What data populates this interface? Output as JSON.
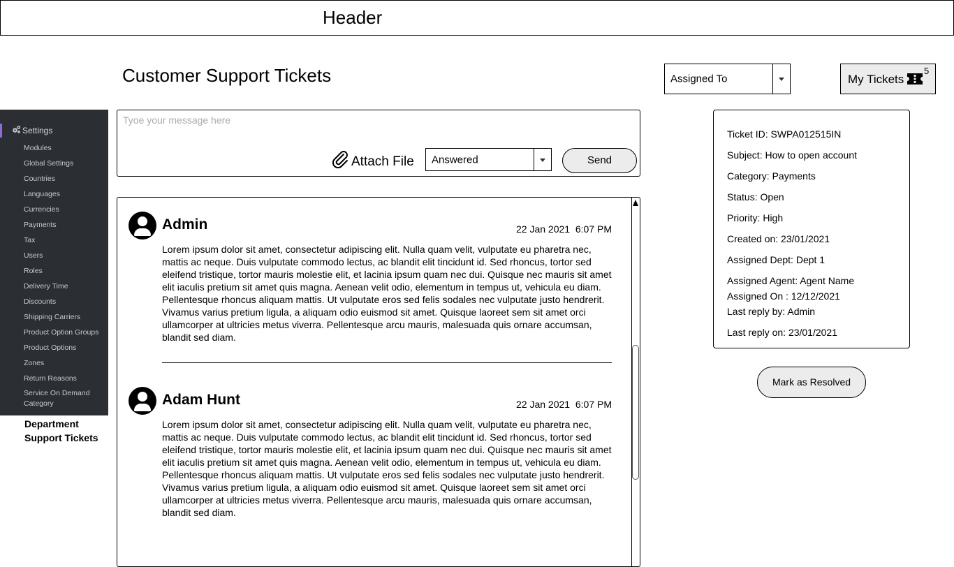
{
  "header": {
    "title": "Header"
  },
  "page": {
    "title": "Customer Support Tickets"
  },
  "filters": {
    "assigned_to": {
      "value": "Assigned To"
    },
    "my_tickets": {
      "label": "My Tickets",
      "count": "5",
      "icon": "ticket-icon"
    }
  },
  "sidebar": {
    "settings_label": "Settings",
    "settings_icon": "gears-icon",
    "accent": "#8e6bd8",
    "background": "#2b2f33",
    "items": [
      {
        "label": "Modules"
      },
      {
        "label": "Global Settings"
      },
      {
        "label": "Countries"
      },
      {
        "label": "Languages"
      },
      {
        "label": "Currencies"
      },
      {
        "label": "Payments"
      },
      {
        "label": "Tax"
      },
      {
        "label": "Users"
      },
      {
        "label": "Roles"
      },
      {
        "label": "Delivery Time"
      },
      {
        "label": "Discounts"
      },
      {
        "label": "Shipping Carriers"
      },
      {
        "label": "Product Option Groups"
      },
      {
        "label": "Product Options"
      },
      {
        "label": "Zones"
      },
      {
        "label": "Return Reasons"
      },
      {
        "label": "Service On Demand Category"
      }
    ],
    "department_link": "Department Support Tickets"
  },
  "composer": {
    "placeholder": "Tyoe your message here",
    "attach_label": "Attach File",
    "attach_icon": "paperclip-icon",
    "status_value": "Answered",
    "send_label": "Send"
  },
  "messages": [
    {
      "author": "Admin",
      "timestamp": "22 Jan 2021  6:07 PM",
      "body": "Lorem ipsum dolor sit amet, consectetur adipiscing elit. Nulla quam velit, vulputate eu pharetra nec, mattis ac neque. Duis vulputate commodo lectus, ac blandit elit tincidunt id. Sed rhoncus, tortor sed eleifend tristique, tortor mauris molestie elit, et lacinia ipsum quam nec dui. Quisque nec mauris sit amet elit iaculis pretium sit amet quis magna. Aenean velit odio, elementum in tempus ut, vehicula eu diam. Pellentesque rhoncus aliquam mattis. Ut vulputate eros sed felis sodales nec vulputate justo hendrerit. Vivamus varius pretium ligula, a aliquam odio euismod sit amet. Quisque laoreet sem sit amet orci ullamcorper at ultricies metus viverra. Pellentesque arcu mauris, malesuada quis ornare accumsan, blandit sed diam."
    },
    {
      "author": "Adam Hunt",
      "timestamp": "22 Jan 2021  6:07 PM",
      "body": "Lorem ipsum dolor sit amet, consectetur adipiscing elit. Nulla quam velit, vulputate eu pharetra nec, mattis ac neque. Duis vulputate commodo lectus, ac blandit elit tincidunt id. Sed rhoncus, tortor sed eleifend tristique, tortor mauris molestie elit, et lacinia ipsum quam nec dui. Quisque nec mauris sit amet elit iaculis pretium sit amet quis magna. Aenean velit odio, elementum in tempus ut, vehicula eu diam. Pellentesque rhoncus aliquam mattis. Ut vulputate eros sed felis sodales nec vulputate justo hendrerit. Vivamus varius pretium ligula, a aliquam odio euismod sit amet. Quisque laoreet sem sit amet orci ullamcorper at ultricies metus viverra. Pellentesque arcu mauris, malesuada quis ornare accumsan, blandit sed diam."
    }
  ],
  "ticket": {
    "id": "Ticket ID: SWPA012515IN",
    "subject": "Subject: How to open account",
    "category": "Category: Payments",
    "status": "Status: Open",
    "priority": "Priority: High",
    "created_on": "Created on: 23/01/2021",
    "assigned_dept": "Assigned Dept: Dept 1",
    "assigned_agent": "Assigned Agent: Agent Name",
    "assigned_on": "Assigned On : 12/12/2021",
    "last_reply_by": "Last reply by: Admin",
    "last_reply_on": "Last reply on: 23/01/2021"
  },
  "actions": {
    "resolve_label": "Mark as Resolved"
  }
}
